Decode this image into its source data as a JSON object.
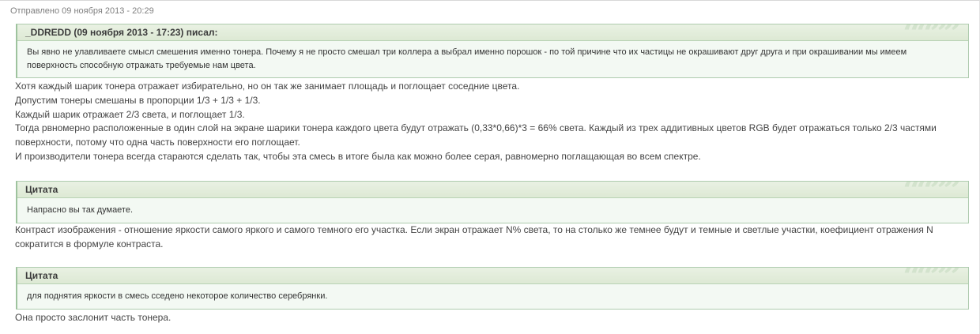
{
  "post": {
    "sent_label": "Отправлено 09 ноября 2013 - 20:29"
  },
  "quotes": [
    {
      "header": "_DDREDD (09 ноября 2013 - 17:23) писал:",
      "body": [
        "Вы явно не улавливаете смысл смешения именно тонера. Почему я не просто смешал три коллера а выбрал именно порошок - по той причине что их частицы не окрашивают друг друга и при окрашивании мы имеем",
        "поверхность способную отражать требуемые нам цвета."
      ]
    },
    {
      "header": "Цитата",
      "body": [
        "Напрасно вы так думаете."
      ]
    },
    {
      "header": "Цитата",
      "body": [
        "для поднятия яркости в смесь сседено некоторое количество серебрянки."
      ]
    }
  ],
  "paragraphs": [
    [
      "Хотя каждый шарик тонера отражает избирательно, но он так же занимает площадь и поглощает соседние цвета.",
      "Допустим тонеры смешаны в пропорции 1/3 + 1/3 + 1/3.",
      "Каждый шарик отражает 2/3 света, и поглощает 1/3.",
      "Тогда рвномерно расположенные в один слой на экране шарики тонера каждого цвета будут отражать (0,33*0,66)*3 = 66% света. Каждый из трех аддитивных цветов RGB будет отражаться только 2/3 частями",
      "поверхности, потому что одна часть поверхности его поглощает.",
      "И производители тонера всегда стараются сделать так, чтобы эта смесь в итоге была как можно более серая, равномерно поглащающая во всем спектре."
    ],
    [
      "Контраст изображения - отношение яркости самого яркого и самого темного его участка. Если экран отражает N% света, то на столько же темнее будут и темные и светлые участки, коефициент отражения N",
      "сократится в формуле контраста."
    ],
    [
      "Она просто заслонит часть тонера."
    ]
  ],
  "quote_marks": "““””"
}
